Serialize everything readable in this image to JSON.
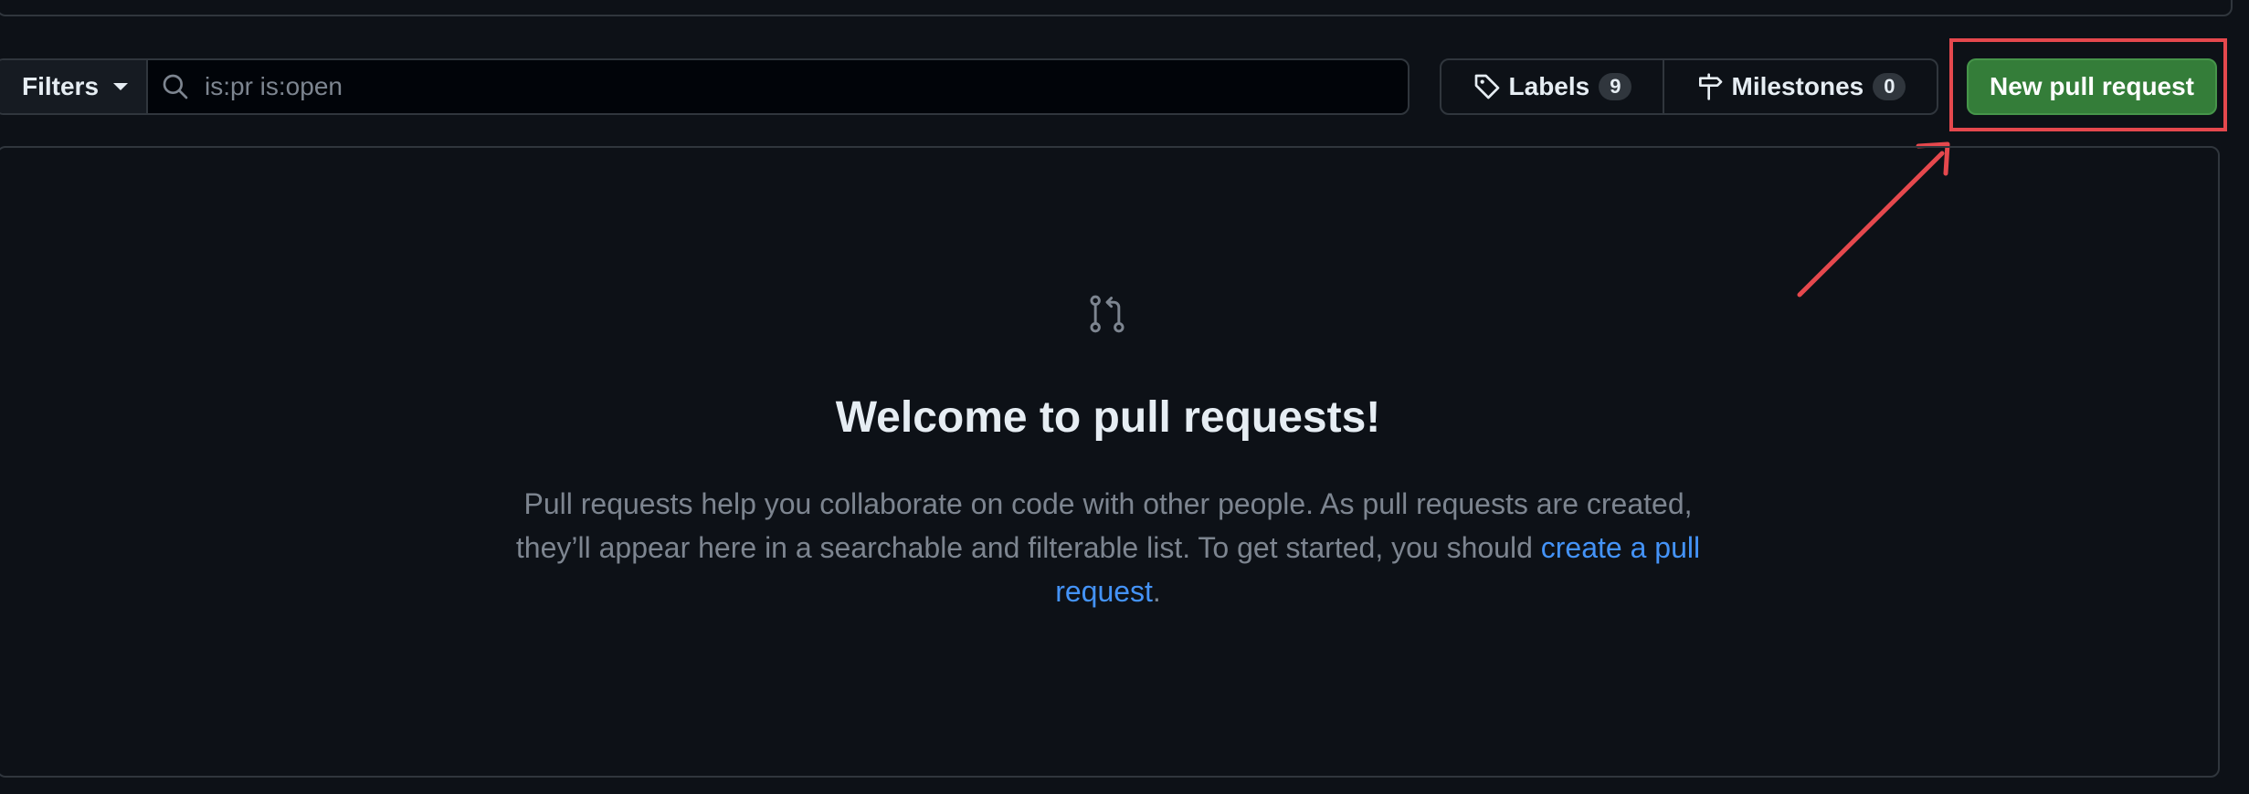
{
  "toolbar": {
    "filters_label": "Filters",
    "search_placeholder": "is:pr is:open",
    "labels_label": "Labels",
    "labels_count": "9",
    "milestones_label": "Milestones",
    "milestones_count": "0",
    "new_pr_label": "New pull request"
  },
  "blankslate": {
    "title": "Welcome to pull requests!",
    "text_before_link": "Pull requests help you collaborate on code with other people. As pull requests are created, they’ll appear here in a searchable and filterable list. To get started, you should ",
    "link_text": "create a pull request",
    "text_after_link": "."
  },
  "colors": {
    "background": "#0d1117",
    "border": "#30363d",
    "primary_button": "#347d39",
    "link": "#4493f8",
    "annotation": "#e5484d"
  },
  "icons": {
    "search": "search-icon",
    "labels": "tag-icon",
    "milestones": "milestone-icon",
    "pull_request": "git-pull-request-icon"
  }
}
